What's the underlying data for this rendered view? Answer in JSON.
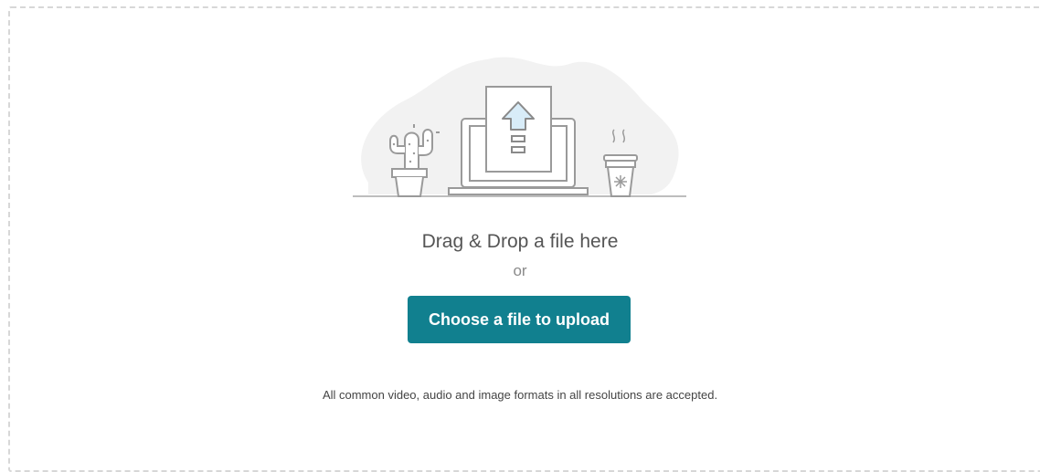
{
  "upload": {
    "drag_text": "Drag & Drop a file here",
    "or_text": "or",
    "button_label": "Choose a file to upload",
    "formats_note": "All common video, audio and image formats in all resolutions are accepted."
  },
  "illustration": {
    "icons": [
      "upload-arrow-icon",
      "laptop-icon",
      "cactus-icon",
      "coffee-cup-icon"
    ]
  },
  "colors": {
    "accent": "#11808f",
    "border": "#d7d7d7",
    "arrow_fill": "#d8ecf8",
    "line": "#9a9a9a",
    "blob": "#f2f2f2"
  }
}
